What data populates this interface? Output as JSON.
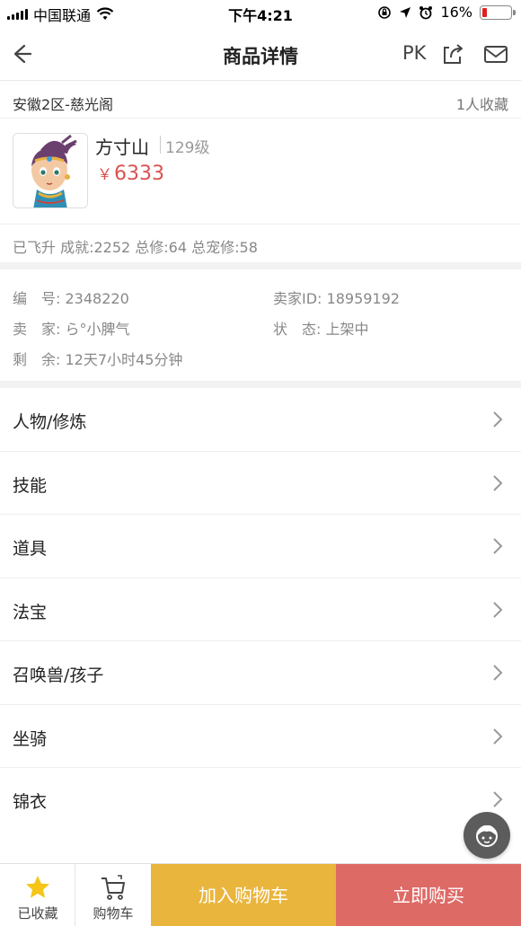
{
  "status_bar": {
    "carrier": "中国联通",
    "time": "下午4:21",
    "battery": "16%",
    "battery_level": 0.16,
    "icons": [
      "signal-icon",
      "wifi-icon",
      "orientation-lock-icon",
      "location-icon",
      "alarm-icon",
      "battery-icon"
    ]
  },
  "nav": {
    "title": "商品详情",
    "pk_label": "PK",
    "icons": [
      "back-arrow-icon",
      "share-icon",
      "mail-icon"
    ]
  },
  "server": {
    "name": "安徽2区-慈光阁",
    "favorites": "1人收藏"
  },
  "character": {
    "name": "方寸山",
    "level": "129级",
    "currency": "￥",
    "price": "6333",
    "stats": "已飞升 成就:2252 总修:64 总宠修:58"
  },
  "info": {
    "id_label": "编　号:",
    "id_value": "2348220",
    "seller_id_label": "卖家ID:",
    "seller_id_value": "18959192",
    "seller_label": "卖　家:",
    "seller_value": "ら°小脾气",
    "status_label": "状　态:",
    "status_value": "上架中",
    "remain_label": "剩　余:",
    "remain_value": "12天7小时45分钟"
  },
  "menu": {
    "items": [
      {
        "label": "人物/修炼"
      },
      {
        "label": "技能"
      },
      {
        "label": "道具"
      },
      {
        "label": "法宝"
      },
      {
        "label": "召唤兽/孩子"
      },
      {
        "label": "坐骑"
      },
      {
        "label": "锦衣"
      }
    ]
  },
  "bottom_bar": {
    "favorited_label": "已收藏",
    "cart_label": "购物车",
    "add_to_cart": "加入购物车",
    "buy_now": "立即购买"
  },
  "colors": {
    "price": "#d9534f",
    "add_to_cart_bg": "#e9b53c",
    "buy_now_bg": "#de6a66",
    "star": "#f5c518"
  }
}
